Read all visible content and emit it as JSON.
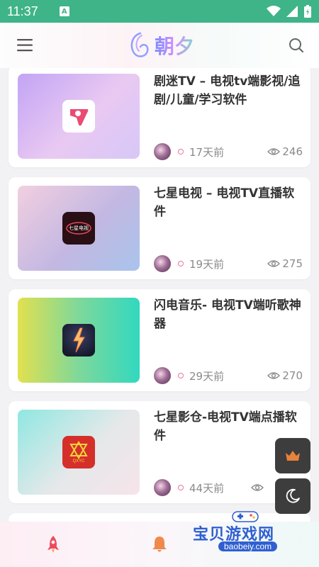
{
  "status": {
    "time": "11:37",
    "a_label": "A"
  },
  "header": {
    "logo_text": "朝夕"
  },
  "articles": [
    {
      "title": "剧迷TV – 电视tv端影视/追剧/儿童/学习软件",
      "time": "17天前",
      "views": "246",
      "icon_label": ""
    },
    {
      "title": "七星电视 – 电视TV直播软件",
      "time": "19天前",
      "views": "275",
      "icon_label": "七星电视"
    },
    {
      "title": "闪电音乐- 电视TV端听歌神器",
      "time": "29天前",
      "views": "270",
      "icon_label": ""
    },
    {
      "title": "七星影仓-电视TV端点播软件",
      "time": "44天前",
      "views": "",
      "icon_label": "QXYC"
    }
  ],
  "watermark": {
    "title": "宝贝游戏网",
    "url": "baobeiy.com"
  },
  "colors": {
    "status_bar": "#3fb489",
    "accent_pink": "#e67aa0",
    "crown": "#e8823a",
    "nav_rocket": "#ee4b5e",
    "nav_bell": "#f08a4b"
  },
  "icons": {
    "menu": "menu-icon",
    "search": "search-icon",
    "crown": "crown-icon",
    "moon": "moon-icon",
    "rocket": "rocket-icon",
    "bell": "bell-icon",
    "eye": "eye-icon"
  }
}
